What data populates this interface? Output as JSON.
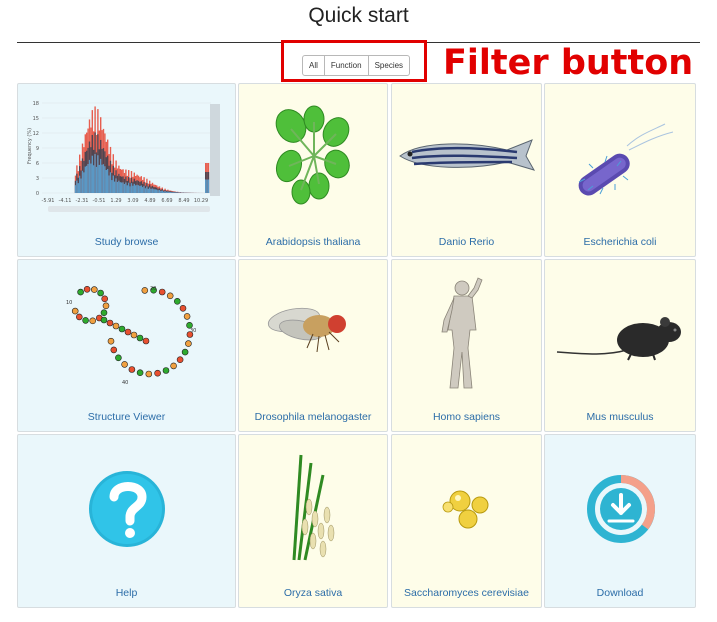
{
  "header": {
    "title": "Quick start"
  },
  "filter": {
    "buttons": [
      "All",
      "Function",
      "Species"
    ],
    "annotation": "Filter button"
  },
  "tiles": [
    {
      "label": "Study browse",
      "icon": "histogram-chart-icon",
      "bg": "blue"
    },
    {
      "label": "Arabidopsis thaliana",
      "icon": "arabidopsis-plant-icon",
      "bg": "yellow"
    },
    {
      "label": "Danio Rerio",
      "icon": "zebrafish-icon",
      "bg": "yellow"
    },
    {
      "label": "Escherichia coli",
      "icon": "bacterium-icon",
      "bg": "yellow"
    },
    {
      "label": "Structure Viewer",
      "icon": "rna-structure-icon",
      "bg": "blue"
    },
    {
      "label": "Drosophila melanogaster",
      "icon": "fruit-fly-icon",
      "bg": "yellow"
    },
    {
      "label": "Homo sapiens",
      "icon": "human-statue-icon",
      "bg": "yellow"
    },
    {
      "label": "Mus musculus",
      "icon": "mouse-icon",
      "bg": "yellow"
    },
    {
      "label": "Help",
      "icon": "help-question-icon",
      "bg": "blue"
    },
    {
      "label": "Oryza sativa",
      "icon": "rice-plant-icon",
      "bg": "yellow"
    },
    {
      "label": "Saccharomyces cerevisiae",
      "icon": "yeast-cells-icon",
      "bg": "yellow"
    },
    {
      "label": "Download",
      "icon": "download-icon",
      "bg": "blue"
    }
  ],
  "chart_data": {
    "type": "bar",
    "ylabel": "Frequency (%)",
    "yticks": [
      "0",
      "3",
      "6",
      "9",
      "12",
      "15",
      "18"
    ],
    "xticks": [
      "-5.91",
      "-4.11",
      "-2.31",
      "-0.51",
      "1.29",
      "3.09",
      "4.89",
      "6.69",
      "8.49",
      "10.29"
    ]
  },
  "colors": {
    "accent_red": "#e10000",
    "link": "#2c6da8",
    "tile_blue": "#eaf7fb",
    "tile_yellow": "#fefde9"
  }
}
